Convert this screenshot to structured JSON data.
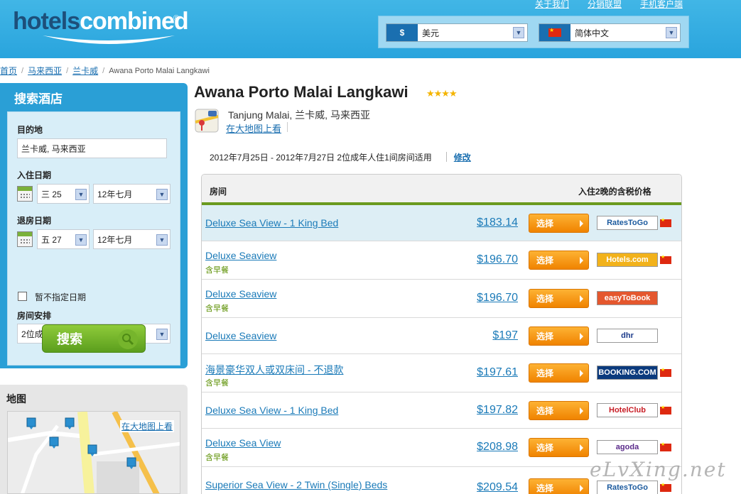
{
  "header": {
    "logo_hotels": "hotels",
    "logo_combined": "combined",
    "logo_reg": "®",
    "links": [
      "关于我们",
      "分销联盟",
      "手机客户端"
    ],
    "currency": {
      "symbol": "$",
      "value": "美元"
    },
    "language": {
      "value": "简体中文"
    },
    "colors": {
      "header_bg": "#2fa9e0",
      "logo_dark": "#1d4f7a"
    }
  },
  "breadcrumb": {
    "home": "首页",
    "country": "马来西亚",
    "city": "兰卡威",
    "current": "Awana Porto Malai Langkawi",
    "sep": "/"
  },
  "search": {
    "title": "搜索酒店",
    "destination_label": "目的地",
    "destination_value": "兰卡威, 马来西亚",
    "checkin_label": "入住日期",
    "checkin_day": "三 25",
    "checkin_month": "12年七月",
    "checkout_label": "退房日期",
    "checkout_day": "五 27",
    "checkout_month": "12年七月",
    "no_dates_label": "暂不指定日期",
    "rooms_label": "房间安排",
    "rooms_value": "2位成年人住1间",
    "button_label": "搜索"
  },
  "map": {
    "title": "地图",
    "large_map_link": "在大地图上看"
  },
  "hotel": {
    "name": "Awana Porto Malai Langkawi",
    "stars": "★★★★",
    "address": "Tanjung Malai, 兰卡威, 马来西亚",
    "large_map_link": "在大地图上看"
  },
  "dates_bar": {
    "text": "2012年7月25日 - 2012年7月27日 2位成年人住1间房间适用",
    "modify_link": "修改"
  },
  "results": {
    "col_room": "房间",
    "col_price": "入住2晚的含税价格",
    "select_label": "选择",
    "rows": [
      {
        "room": "Deluxe Sea View - 1 King Bed",
        "meal": "",
        "price": "$183.14",
        "provider": "RatesToGo",
        "flag": true
      },
      {
        "room": "Deluxe Seaview ",
        "meal": "含早餐",
        "price": "$196.70",
        "provider": "Hotels.com",
        "flag": true
      },
      {
        "room": "Deluxe Seaview ",
        "meal": "含早餐",
        "price": "$196.70",
        "provider": "easyToBook",
        "flag": false
      },
      {
        "room": "Deluxe Seaview",
        "meal": "",
        "price": "$197",
        "provider": "dhr",
        "flag": false
      },
      {
        "room": "海景豪华双人或双床间 - 不退款 ",
        "meal": "含早餐",
        "price": "$197.61",
        "provider": "BOOKING.COM",
        "flag": true
      },
      {
        "room": "Deluxe Sea View - 1 King Bed",
        "meal": "",
        "price": "$197.82",
        "provider": "HotelClub",
        "flag": true
      },
      {
        "room": "Deluxe Sea View ",
        "meal": "含早餐",
        "price": "$208.98",
        "provider": "agoda",
        "flag": true
      },
      {
        "room": "Superior Sea View - 2 Twin (Single) Beds",
        "meal": "",
        "price": "$209.54",
        "provider": "RatesToGo",
        "flag": true
      }
    ]
  },
  "watermark": "eLvXing.net"
}
